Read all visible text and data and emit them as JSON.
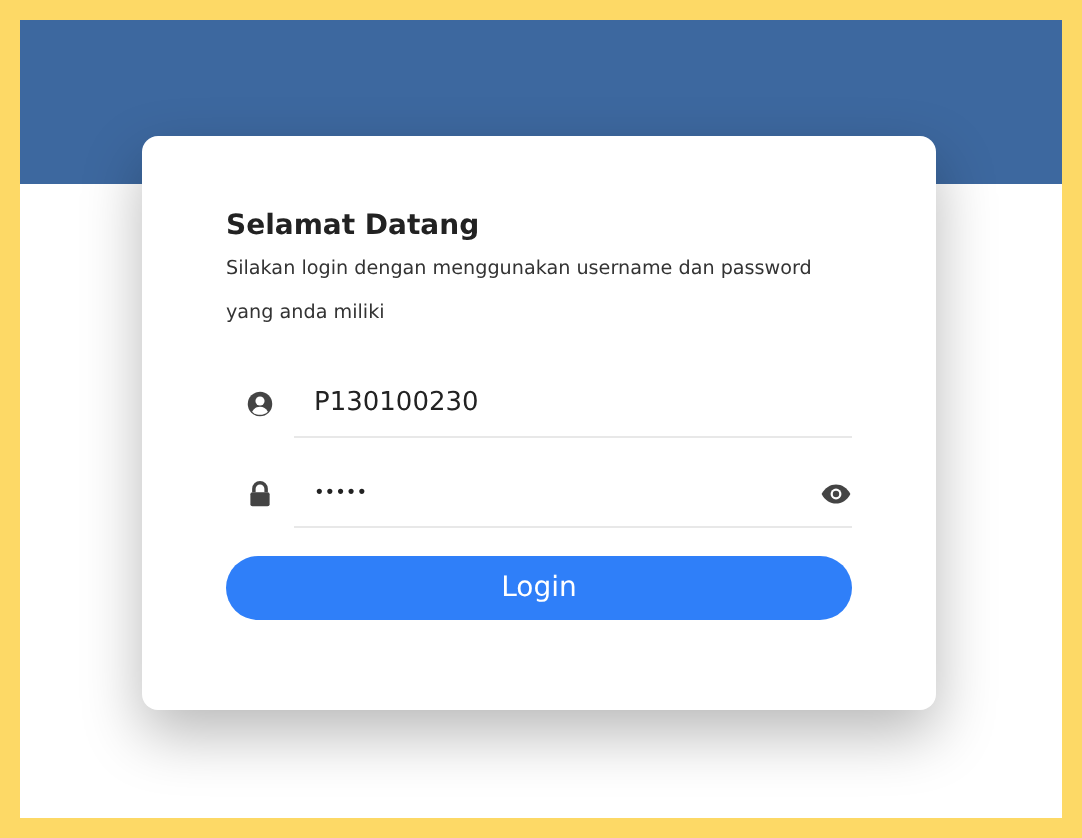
{
  "card": {
    "title": "Selamat Datang",
    "subtitle": "Silakan login dengan menggunakan username dan password yang anda miliki"
  },
  "fields": [
    {
      "kind": "user",
      "value": "P130100230"
    },
    {
      "kind": "password",
      "value": "•••••"
    }
  ],
  "button": {
    "label": "Login"
  }
}
